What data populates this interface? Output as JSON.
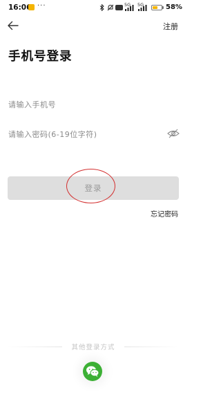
{
  "status_bar": {
    "time": "16:06",
    "more": "···",
    "network_5g": "5G",
    "battery_percent": "58%",
    "battery_level": 0.58,
    "icons": [
      "app-notification-icon",
      "bluetooth-icon",
      "mute-icon",
      "hd-icon",
      "signal-icon",
      "battery-icon"
    ]
  },
  "nav": {
    "back_icon": "arrow-left-icon",
    "register_label": "注册"
  },
  "page": {
    "title": "手机号登录"
  },
  "form": {
    "phone_placeholder": "请输入手机号",
    "password_placeholder": "请输入密码(6-19位字符)",
    "password_visibility_icon": "eye-hidden-icon",
    "login_label": "登录",
    "forgot_label": "忘记密码"
  },
  "other_login": {
    "label": "其他登录方式",
    "wechat_icon": "wechat-icon"
  },
  "colors": {
    "annotation_circle": "#d32f2f",
    "wechat_green": "#3cb035",
    "button_disabled": "#dedede",
    "battery": "#f4b400"
  }
}
